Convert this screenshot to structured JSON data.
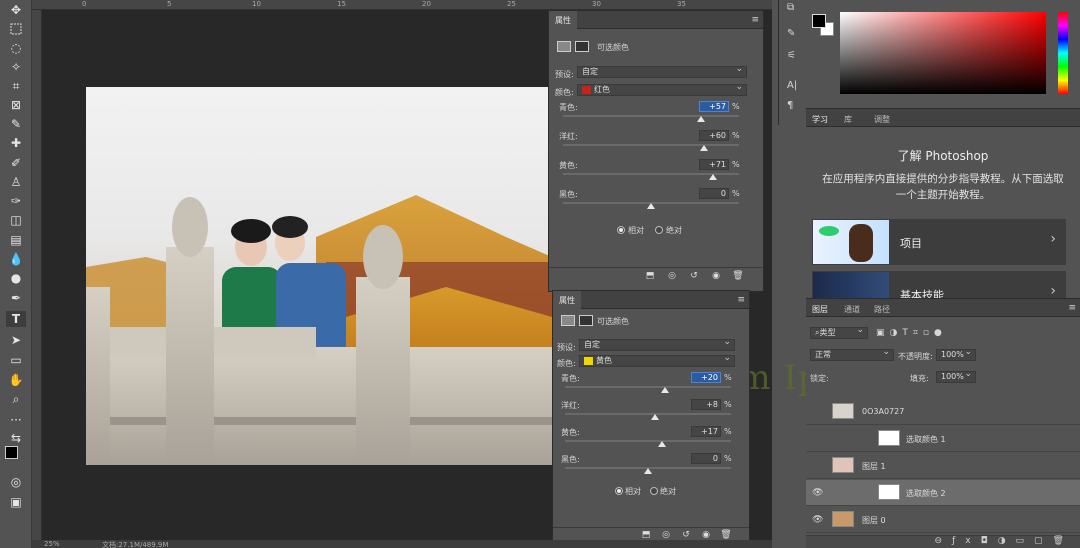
{
  "status": {
    "zoom": "25%",
    "doc": "文档:27.1M/489.9M"
  },
  "props_top": {
    "tab": "属性",
    "title": "可选颜色",
    "preset_label": "预设:",
    "preset_value": "自定",
    "color_label": "颜色:",
    "color_value": "红色",
    "color_swatch": "#c8231a",
    "sliders": [
      {
        "label": "青色:",
        "value": "+57",
        "pct": "%",
        "level": 0.785
      },
      {
        "label": "洋红:",
        "value": "+60",
        "pct": "%",
        "level": 0.8
      },
      {
        "label": "黄色:",
        "value": "+71",
        "pct": "%",
        "level": 0.855
      },
      {
        "label": "黑色:",
        "value": "0",
        "pct": "%",
        "level": 0.5
      }
    ],
    "radio_relative": "相对",
    "radio_absolute": "绝对"
  },
  "props_bottom": {
    "tab": "属性",
    "title": "可选颜色",
    "preset_label": "预设:",
    "preset_value": "自定",
    "color_label": "颜色:",
    "color_value": "黄色",
    "color_swatch": "#f2d600",
    "sliders": [
      {
        "label": "青色:",
        "value": "+20",
        "pct": "%",
        "level": 0.6
      },
      {
        "label": "洋红:",
        "value": "+8",
        "pct": "%",
        "level": 0.54
      },
      {
        "label": "黄色:",
        "value": "+17",
        "pct": "%",
        "level": 0.585
      },
      {
        "label": "黑色:",
        "value": "0",
        "pct": "%",
        "level": 0.5
      }
    ],
    "radio_relative": "相对",
    "radio_absolute": "绝对"
  },
  "learn": {
    "tabs": [
      "学习",
      "库",
      "调整"
    ],
    "heading": "了解 Photoshop",
    "description": "在应用程序内直接提供的分步指导教程。从下面选取一个主题开始教程。",
    "cards": [
      {
        "label": "项目"
      },
      {
        "label": "基本技能"
      }
    ]
  },
  "layers": {
    "tabs": [
      "图层",
      "通道",
      "路径"
    ],
    "filter": "类型",
    "blend_mode": "正常",
    "opacity_label": "不透明度:",
    "opacity_value": "100%",
    "lock_label": "锁定:",
    "fill_label": "填充:",
    "fill_value": "100%",
    "rows": [
      {
        "name": "0O3A0727",
        "visible": false
      },
      {
        "name": "选取颜色 1",
        "visible": false
      },
      {
        "name": "图层 1",
        "visible": false
      },
      {
        "name": "选取颜色 2",
        "visible": true,
        "selected": true
      },
      {
        "name": "图层 0",
        "visible": true
      }
    ]
  },
  "watermark": "Lorem Ipsum",
  "ruler_labels": [
    "0",
    "5",
    "10",
    "15",
    "20",
    "25",
    "30",
    "35"
  ]
}
